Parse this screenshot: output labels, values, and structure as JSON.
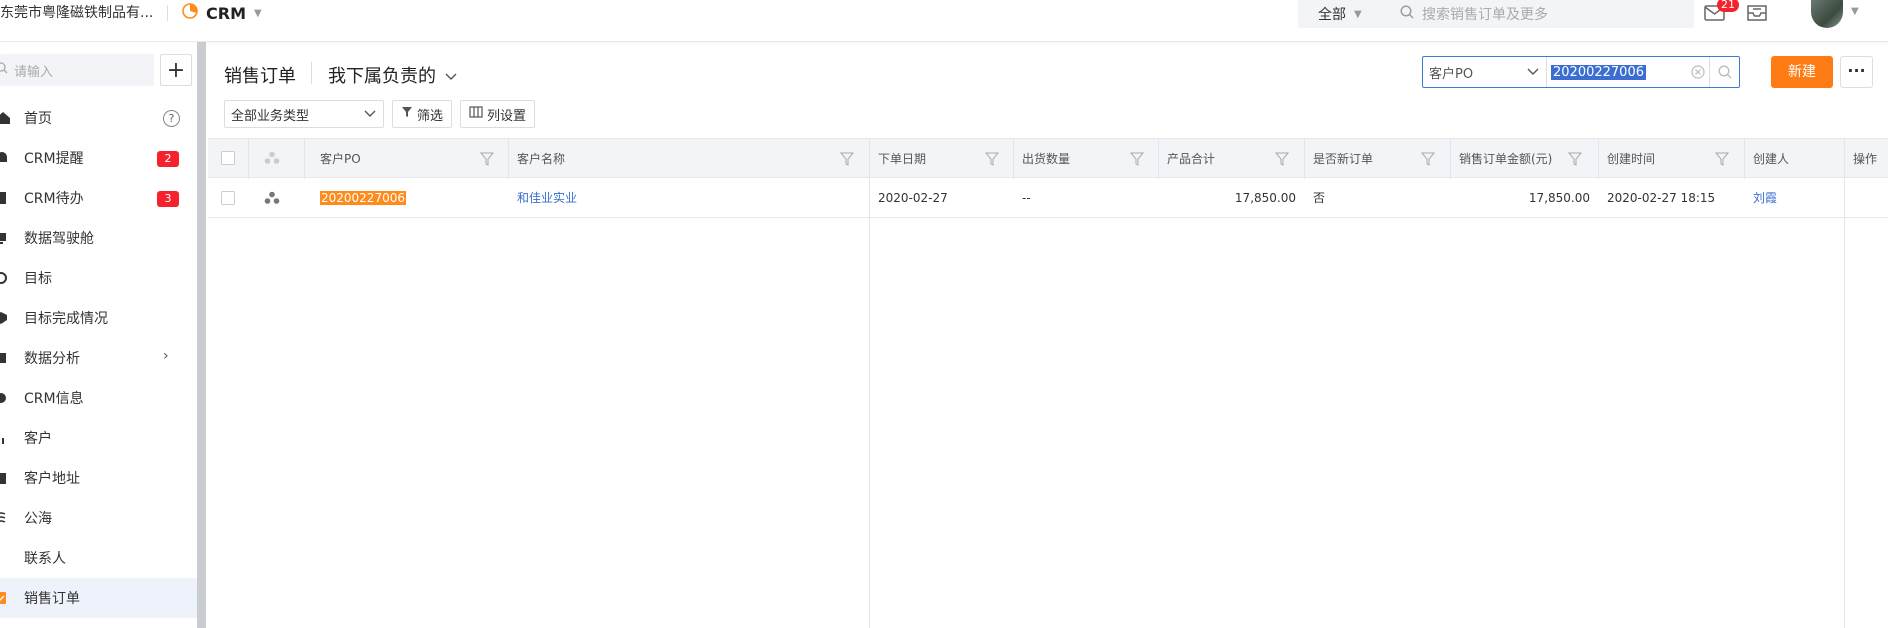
{
  "topbar": {
    "company": "东莞市粤隆磁铁制品有...",
    "app_name": "CRM",
    "search_scope": "全部",
    "search_placeholder": "搜索销售订单及更多",
    "message_badge": "21"
  },
  "sidebar": {
    "search_placeholder": "请输入",
    "items": [
      {
        "label": "首页",
        "icon": "home-icon"
      },
      {
        "label": "CRM提醒",
        "icon": "bell-icon",
        "badge": "2"
      },
      {
        "label": "CRM待办",
        "icon": "todo-icon",
        "badge": "3"
      },
      {
        "label": "数据驾驶舱",
        "icon": "dashboard-icon"
      },
      {
        "label": "目标",
        "icon": "target-icon"
      },
      {
        "label": "目标完成情况",
        "icon": "target-check-icon"
      },
      {
        "label": "数据分析",
        "icon": "analysis-icon"
      },
      {
        "label": "CRM信息",
        "icon": "info-icon"
      },
      {
        "label": "客户",
        "icon": "customer-icon"
      },
      {
        "label": "客户地址",
        "icon": "address-icon"
      },
      {
        "label": "公海",
        "icon": "sea-icon"
      },
      {
        "label": "联系人",
        "icon": "contact-icon"
      },
      {
        "label": "销售订单",
        "icon": "order-icon"
      }
    ]
  },
  "main": {
    "title": "销售订单",
    "view": "我下属负责的",
    "search_field_type": "客户PO",
    "search_value": "20200227006",
    "new_label": "新建",
    "more_label": "···",
    "business_type": "全部业务类型",
    "filter_label": "筛选",
    "columns_label": "列设置"
  },
  "table": {
    "headers": [
      "客户PO",
      "客户名称",
      "下单日期",
      "出货数量",
      "产品合计",
      "是否新订单",
      "销售订单金额(元)",
      "创建时间",
      "创建人",
      "操作"
    ],
    "rows": [
      {
        "po": "20200227006",
        "customer": "和佳业实业",
        "order_date": "2020-02-27",
        "ship_qty": "--",
        "product_total": "17,850.00",
        "is_new": "否",
        "amount": "17,850.00",
        "created_at": "2020-02-27 18:15",
        "creator": "刘霞"
      }
    ]
  },
  "colors": {
    "accent_orange": "#ff7c14",
    "link_blue": "#3a6fd1",
    "badge_red": "#f5222d"
  }
}
